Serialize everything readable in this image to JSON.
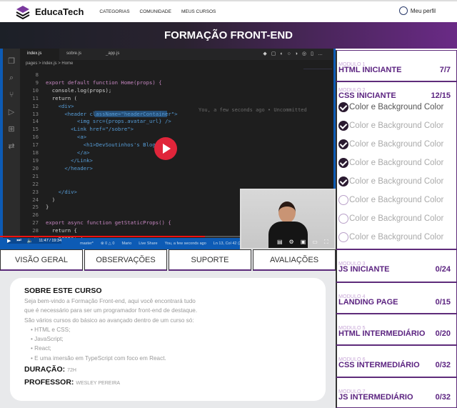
{
  "header": {
    "brand": "EducaTech",
    "nav": [
      "CATEGORIAS",
      "COMUNIDADE",
      "MEUS CURSOS"
    ],
    "profile": "Meu perfil"
  },
  "banner": {
    "title": "FORMAÇÃO FRONT-END"
  },
  "video": {
    "editor_tabs": [
      "index.js",
      "sobre.js",
      "_app.js"
    ],
    "breadcrumb": "pages > index.js > Home",
    "code": [
      [
        "8",
        ""
      ],
      [
        "9",
        "export default function Home(props) {"
      ],
      [
        "10",
        "  console.log(props);"
      ],
      [
        "11",
        "  return ("
      ],
      [
        "12",
        "    <div>"
      ],
      [
        "13",
        "      <header className=\"headerContainer\">"
      ],
      [
        "14",
        "          <img src={props.avatar_url} />"
      ],
      [
        "15",
        "        <Link href=\"/sobre\">"
      ],
      [
        "16",
        "          <a>"
      ],
      [
        "17",
        "            <h1>DevSoutinhos's Blog"
      ],
      [
        "18",
        "          </a>"
      ],
      [
        "19",
        "        </Link>"
      ],
      [
        "20",
        "      </header>"
      ],
      [
        "21",
        ""
      ],
      [
        "22",
        ""
      ],
      [
        "23",
        "    </div>"
      ],
      [
        "24",
        "  )"
      ],
      [
        "25",
        "}"
      ],
      [
        "26",
        ""
      ],
      [
        "27",
        "export async function getStaticProps() {"
      ],
      [
        "28",
        "  return {"
      ],
      [
        "29",
        "    props: {"
      ]
    ],
    "blame": "You, a few seconds ago • Uncommitted",
    "time": "11:47 / 19:34",
    "status": [
      "master*",
      "⊗ 0 △ 0",
      "Mario",
      "Live Share",
      "You, a few seconds ago",
      "Ln 13, Col 42 (27 selected)"
    ],
    "progress_percent": 61,
    "accent": "#e0253a"
  },
  "tabs": [
    "VISÃO GERAL",
    "OBSERVAÇÕES",
    "SUPORTE",
    "AVALIAÇÕES"
  ],
  "about": {
    "title": "SOBRE ESTE CURSO",
    "intro": [
      "Seja bem-vindo a Formação Front-end, aqui você encontrará tudo",
      "que é necessário para ser um programador front-end de destaque.",
      "São vários cursos do básico ao avançado dentro de um curso só:"
    ],
    "items": [
      "HTML e CSS;",
      "JavaScript;",
      "React;",
      "E uma imersão em TypeScript com foco em React."
    ],
    "duration_label": "DURAÇÃO:",
    "duration": "72H",
    "teacher_label": "PROFESSOR:",
    "teacher": "WESLEY PEREIRA"
  },
  "modules": [
    {
      "num": "MODULO 1",
      "title": "HTML INICIANTE",
      "count": "7/7"
    },
    {
      "num": "MODULO 2",
      "title": "CSS INICIANTE",
      "count": "12/15",
      "lessons": [
        {
          "label": "Color e Background Color",
          "done": true
        },
        {
          "label": "Color e Background Color",
          "done": true
        },
        {
          "label": "Color e Background Color",
          "done": true
        },
        {
          "label": "Color e Background Color",
          "done": true
        },
        {
          "label": "Color e Background Color",
          "done": true
        },
        {
          "label": "Color e Background Color",
          "done": false
        },
        {
          "label": "Color e Background Color",
          "done": false
        },
        {
          "label": "Color e Background Color",
          "done": false
        }
      ]
    },
    {
      "num": "MODULO 3",
      "title": "JS INICIANTE",
      "count": "0/24"
    },
    {
      "num": "MODULO 4",
      "title": "LANDING PAGE",
      "count": "0/15"
    },
    {
      "num": "MODULO 5",
      "title": "HTML INTERMEDIÁRIO",
      "count": "0/20"
    },
    {
      "num": "MODULO 6",
      "title": "CSS INTERMEDIÁRIO",
      "count": "0/32"
    },
    {
      "num": "MODULO 7",
      "title": "JS INTERMEDIÁRIO",
      "count": "0/32"
    }
  ],
  "colors": {
    "brand": "#5b2380",
    "banner_start": "#1c2027",
    "banner_end": "#6a2a86"
  }
}
